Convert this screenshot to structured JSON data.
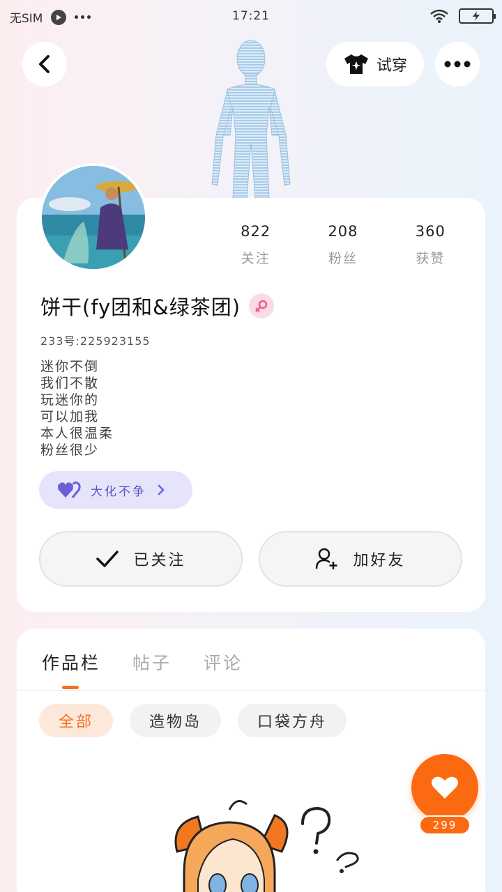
{
  "status_bar": {
    "carrier": "无SIM",
    "time": "17:21"
  },
  "header": {
    "tryon_label": "试穿"
  },
  "profile": {
    "stats": [
      {
        "value": "822",
        "label": "关注"
      },
      {
        "value": "208",
        "label": "粉丝"
      },
      {
        "value": "360",
        "label": "获赞"
      }
    ],
    "nickname": "饼干(fy团和&绿茶团)",
    "gender": "female",
    "uid": "233号:225923155",
    "bio": [
      "迷你不倒",
      "我们不散",
      "玩迷你的",
      "可以加我",
      "本人很温柔",
      "粉丝很少"
    ],
    "badge_label": "大化不争",
    "follow_label": "已关注",
    "add_friend_label": "加好友"
  },
  "works": {
    "tabs": [
      "作品栏",
      "帖子",
      "评论"
    ],
    "active_tab": 0,
    "chips": [
      "全部",
      "造物岛",
      "口袋方舟"
    ],
    "active_chip": 0
  },
  "fab": {
    "count": "299"
  },
  "colors": {
    "accent": "#fb6a11",
    "badge_bg": "#e6e4fb",
    "badge_text": "#5a55c4"
  }
}
